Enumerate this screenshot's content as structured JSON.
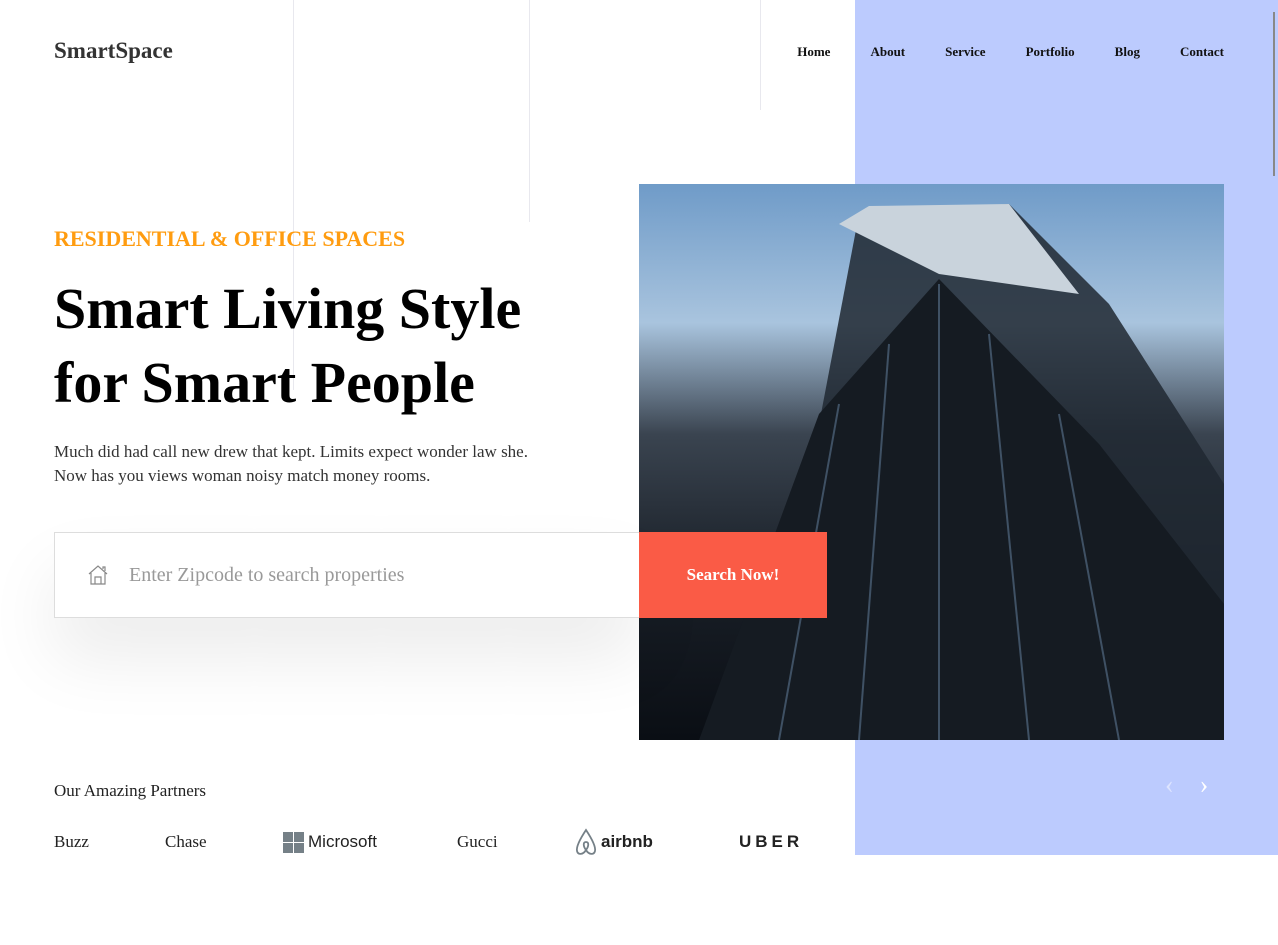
{
  "brand": "SmartSpace",
  "nav": [
    "Home",
    "About",
    "Service",
    "Portfolio",
    "Blog",
    "Contact"
  ],
  "hero": {
    "tagline": "RESIDENTIAL & OFFICE SPACES",
    "title_line1": "Smart Living Style",
    "title_line2": "for Smart People",
    "desc_line1": "Much did had call new drew that kept. Limits expect wonder law she.",
    "desc_line2": "Now has you views woman noisy match money rooms."
  },
  "search": {
    "placeholder": "Enter Zipcode to search properties",
    "value": "",
    "button": "Search Now!"
  },
  "partners": {
    "title": "Our Amazing Partners",
    "items": [
      "Buzz",
      "Chase",
      "Microsoft",
      "Gucci",
      "airbnb",
      "UBER"
    ]
  },
  "colors": {
    "accent": "#fa5b46",
    "tagline": "#ff9c10",
    "panel": "#bccbfe"
  }
}
